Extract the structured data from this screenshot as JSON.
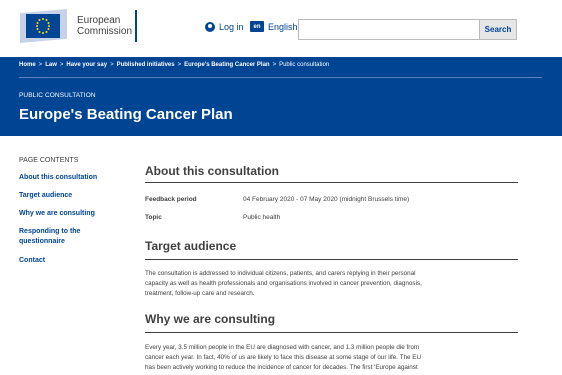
{
  "header": {
    "logo_line1": "European",
    "logo_line2": "Commission",
    "login_label": "Log in",
    "language_code": "en",
    "language_label": "English",
    "search_placeholder": "",
    "search_button": "Search"
  },
  "breadcrumb": {
    "items": [
      "Home",
      "Law",
      "Have your say",
      "Published initiatives",
      "Europe's Beating Cancer Plan"
    ],
    "current": "Public consultation"
  },
  "page": {
    "meta_label": "PUBLIC CONSULTATION",
    "title": "Europe's Beating Cancer Plan"
  },
  "toc": {
    "title": "PAGE CONTENTS",
    "items": [
      "About this consultation",
      "Target audience",
      "Why we are consulting",
      "Responding to the questionnaire",
      "Contact"
    ]
  },
  "about": {
    "heading": "About this consultation",
    "feedback_label": "Feedback period",
    "feedback_value": "04 February 2020 - 07 May 2020  (midnight Brussels time)",
    "topic_label": "Topic",
    "topic_value": "Public health"
  },
  "target": {
    "heading": "Target audience",
    "lines": [
      "The consultation is addressed to individual citizens, patients, and carers replying in their personal",
      "capacity as well as health professionals and organisations involved in cancer prevention, diagnosis,",
      "treatment, follow-up care and research."
    ]
  },
  "why": {
    "heading": "Why we are consulting",
    "lines": [
      "Every year, 3.5 million people in the EU are diagnosed with cancer, and 1.3 million people die from",
      "cancer each year.  In fact, 40% of us are likely to face this disease at some stage of our life. The EU",
      "has been actively working to reduce the incidence of cancer for decades. The first 'Europe against"
    ]
  },
  "colors": {
    "brand_blue": "#004494",
    "text": "#404040"
  }
}
